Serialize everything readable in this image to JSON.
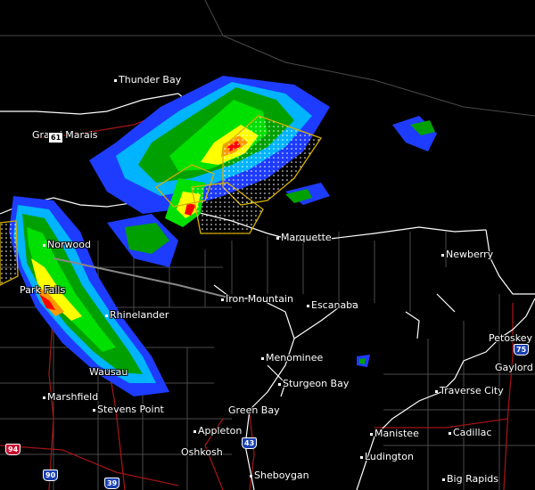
{
  "map": {
    "background_color": "#000000",
    "state_line_color": "#ffffff",
    "county_line_color": "#555555",
    "road_color": "#b01010",
    "warning_polygon_color": "#d4b000",
    "radar_colors": [
      "#1e3cff",
      "#00c8ff",
      "#00a000",
      "#00e000",
      "#ffff00",
      "#ff9900",
      "#ff0000"
    ]
  },
  "cities": [
    {
      "name": "Thunder Bay"
    },
    {
      "name": "Grand Marais"
    },
    {
      "name": "Marquette"
    },
    {
      "name": "Newberry"
    },
    {
      "name": "Norwood"
    },
    {
      "name": "Park Falls"
    },
    {
      "name": "Rhinelander"
    },
    {
      "name": "Iron Mountain"
    },
    {
      "name": "Escanaba"
    },
    {
      "name": "Petoskey"
    },
    {
      "name": "Menominee"
    },
    {
      "name": "Gaylord"
    },
    {
      "name": "Wausau"
    },
    {
      "name": "Sturgeon Bay"
    },
    {
      "name": "Traverse City"
    },
    {
      "name": "Marshfield"
    },
    {
      "name": "Stevens Point"
    },
    {
      "name": "Green Bay"
    },
    {
      "name": "Appleton"
    },
    {
      "name": "Manistee"
    },
    {
      "name": "Cadillac"
    },
    {
      "name": "Oshkosh"
    },
    {
      "name": "Ludington"
    },
    {
      "name": "Sheboygan"
    },
    {
      "name": "Big Rapids"
    }
  ],
  "highway_shields": [
    {
      "label": "61",
      "kind": "hwy"
    },
    {
      "label": "75",
      "kind": "interstate"
    },
    {
      "label": "43",
      "kind": "interstate"
    },
    {
      "label": "94",
      "kind": "interstate"
    },
    {
      "label": "90",
      "kind": "interstate"
    },
    {
      "label": "39",
      "kind": "interstate"
    }
  ]
}
